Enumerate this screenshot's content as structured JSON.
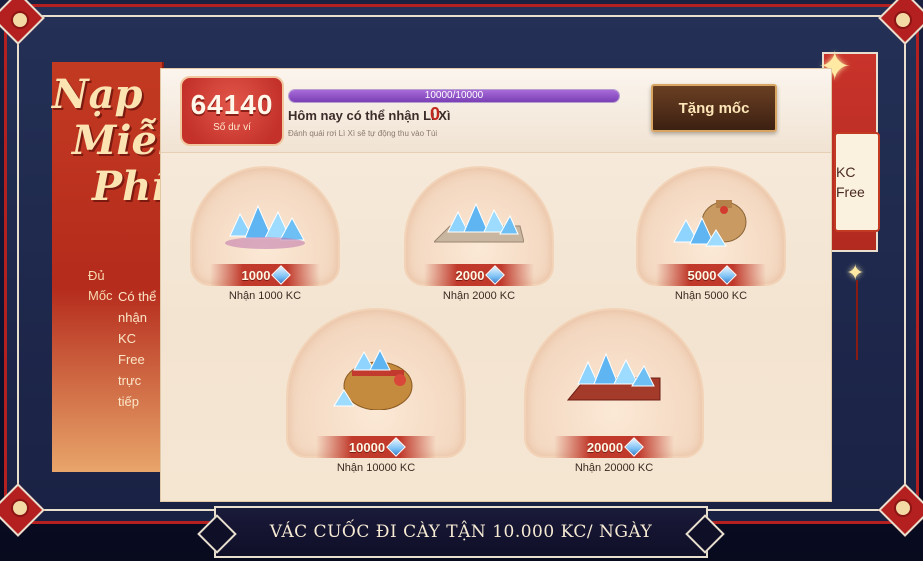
{
  "side_title": [
    "Nạp",
    "Miễn",
    "Phí"
  ],
  "side_label_moc": "Đủ Mốc",
  "side_desc": "Có thể nhận KC Free trực tiếp",
  "right_tab": "KC Free",
  "balance": {
    "value": "64140",
    "label": "Số dư ví"
  },
  "progress": {
    "text": "10000/10000",
    "fraction": 1.0
  },
  "lixi": {
    "label": "Hôm nay có thể nhận Lì Xì",
    "count": "0",
    "note": "Đánh quái rơi Lì Xì sẽ tự động thu vào Túi"
  },
  "milestone_button": "Tặng mốc",
  "rewards": [
    {
      "amount": "1000",
      "label": "Nhận 1000 KC"
    },
    {
      "amount": "2000",
      "label": "Nhận 2000 KC"
    },
    {
      "amount": "5000",
      "label": "Nhận 5000 KC"
    },
    {
      "amount": "10000",
      "label": "Nhận 10000 KC"
    },
    {
      "amount": "20000",
      "label": "Nhận 20000 KC"
    }
  ],
  "bottom_banner": "VÁC CUỐC ĐI CÀY TẬN 10.000 KC/ NGÀY",
  "colors": {
    "frame_red": "#b3201f",
    "panel": "#f7ecde",
    "accent_purple": "#7a3fb4",
    "button_brown": "#4a2a18"
  }
}
